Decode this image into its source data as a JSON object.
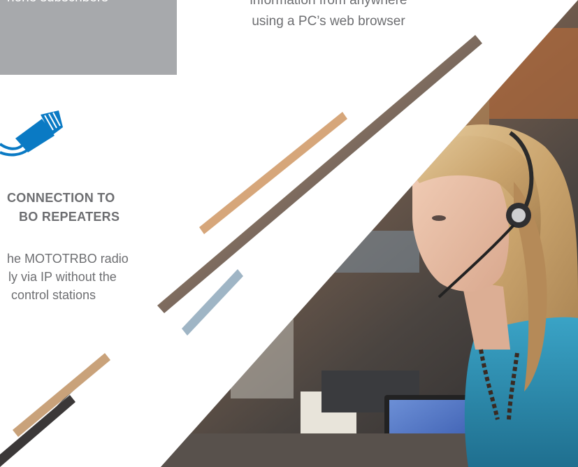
{
  "top_left_box": {
    "text": "hone subscribers"
  },
  "top_center": {
    "line1": "information from anywhere",
    "line2": "using a PC’s web browser"
  },
  "feature": {
    "icon": "ethernet-cable-icon",
    "heading_line1": "CONNECTION TO",
    "heading_line2": "BO REPEATERS",
    "body_line1": "he MOTOTRBO radio",
    "body_line2": "ly via IP without the",
    "body_line3": "control stations"
  },
  "colors": {
    "gray_box": "#a7a9ac",
    "text_gray": "#6d6e71",
    "icon_blue": "#0a7ac4",
    "headset_shirt": "#2a8fb0"
  }
}
